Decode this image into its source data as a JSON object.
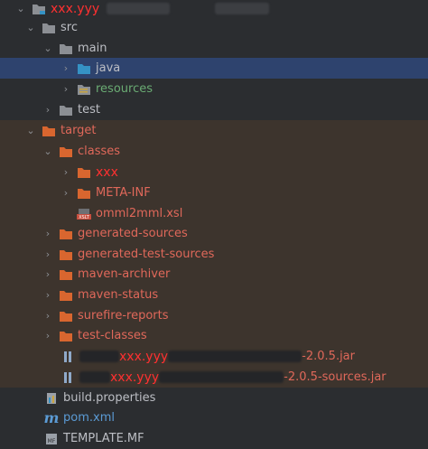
{
  "tree": {
    "root": {
      "label": "xxx.yyy"
    },
    "src": {
      "label": "src"
    },
    "main": {
      "label": "main"
    },
    "java": {
      "label": "java"
    },
    "resources": {
      "label": "resources"
    },
    "test": {
      "label": "test"
    },
    "target": {
      "label": "target"
    },
    "classes": {
      "label": "classes"
    },
    "xxx_pkg": {
      "label": "xxx"
    },
    "meta_inf": {
      "label": "META-INF"
    },
    "xsl_file": {
      "label": "omml2mml.xsl",
      "icon_text": "XSLT"
    },
    "generated_sources": {
      "label": "generated-sources"
    },
    "generated_test_sources": {
      "label": "generated-test-sources"
    },
    "maven_archiver": {
      "label": "maven-archiver"
    },
    "maven_status": {
      "label": "maven-status"
    },
    "surefire_reports": {
      "label": "surefire-reports"
    },
    "test_classes": {
      "label": "test-classes"
    },
    "jar1": {
      "prefix": "xxx.yyy",
      "suffix": "-2.0.5.jar"
    },
    "jar2": {
      "prefix": "xxx.yyy",
      "suffix": "-2.0.5-sources.jar"
    },
    "build_properties": {
      "label": "build.properties"
    },
    "pom": {
      "label": "pom.xml",
      "icon_text": "m"
    },
    "template_mf": {
      "label": "TEMPLATE.MF",
      "icon_text": "MF"
    }
  },
  "colors": {
    "background": "#2b2d30",
    "selection": "#2e436e",
    "target_area": "#3d342d",
    "folder_orange": "#d9662f",
    "excluded_text": "#e0685a",
    "resources_text": "#6aab73",
    "source_folder_blue": "#3592c4"
  }
}
